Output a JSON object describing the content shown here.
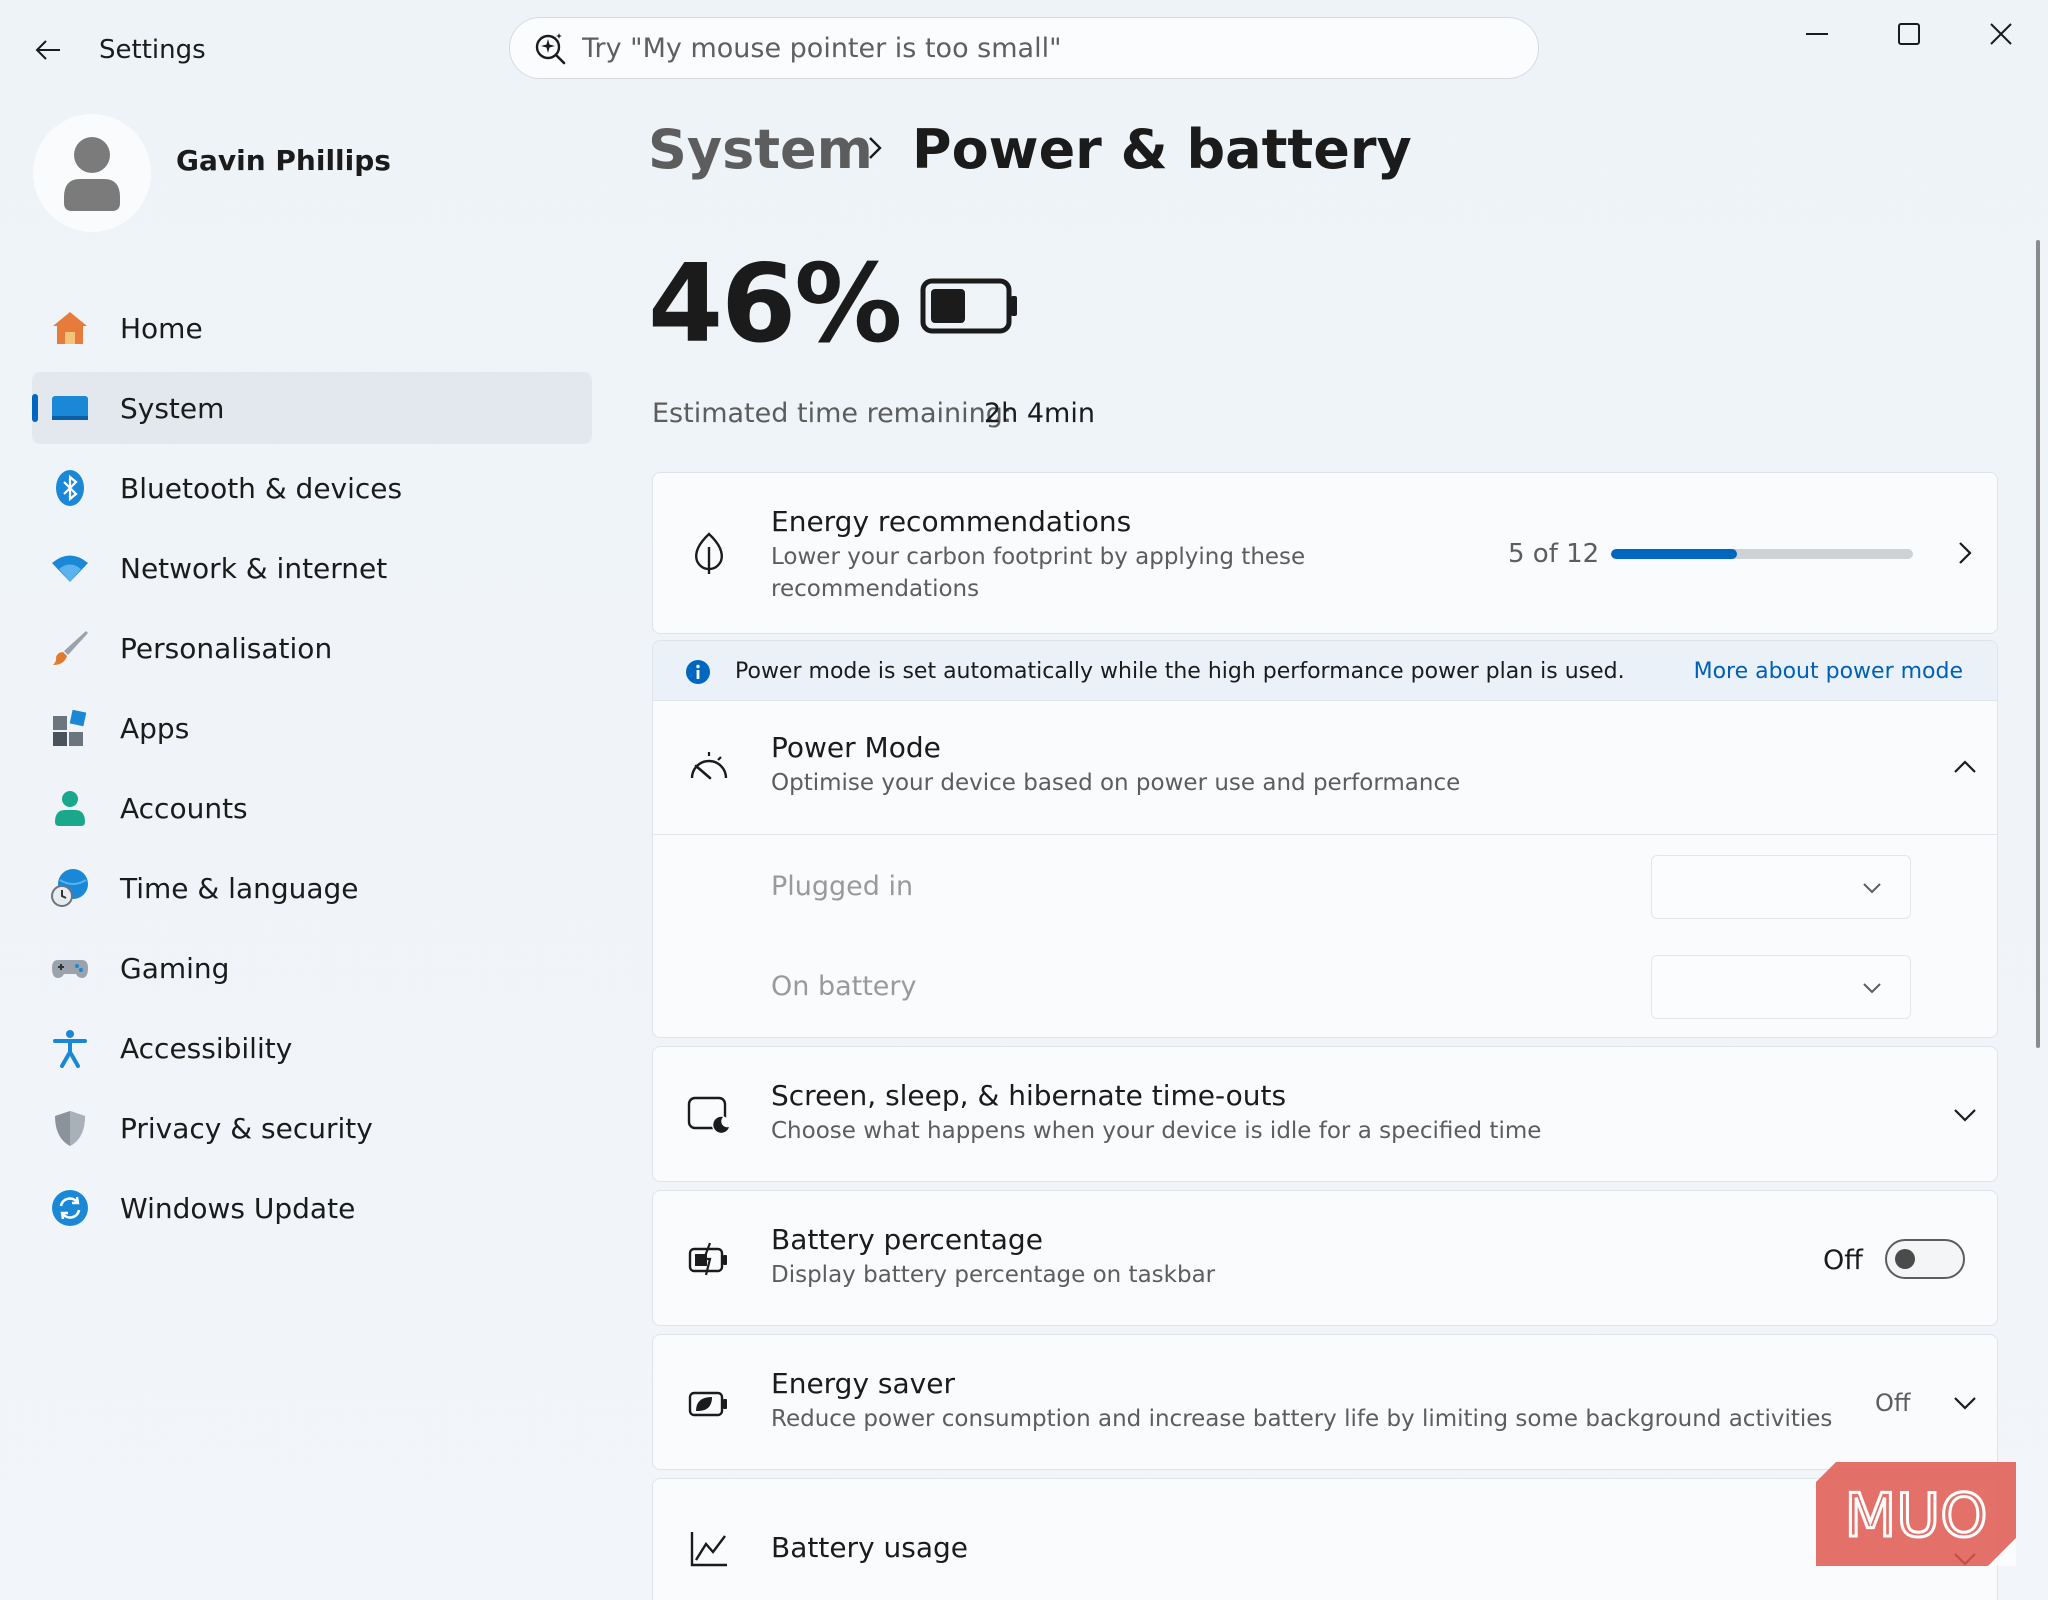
{
  "window": {
    "title": "Settings"
  },
  "search": {
    "placeholder": "Try \"My mouse pointer is too small\""
  },
  "profile": {
    "name": "Gavin Phillips"
  },
  "nav": {
    "items": [
      {
        "label": "Home",
        "icon": "home-icon"
      },
      {
        "label": "System",
        "icon": "system-icon",
        "active": true
      },
      {
        "label": "Bluetooth & devices",
        "icon": "bluetooth-icon"
      },
      {
        "label": "Network & internet",
        "icon": "wifi-icon"
      },
      {
        "label": "Personalisation",
        "icon": "paintbrush-icon"
      },
      {
        "label": "Apps",
        "icon": "apps-icon"
      },
      {
        "label": "Accounts",
        "icon": "accounts-icon"
      },
      {
        "label": "Time & language",
        "icon": "globe-clock-icon"
      },
      {
        "label": "Gaming",
        "icon": "gamepad-icon"
      },
      {
        "label": "Accessibility",
        "icon": "accessibility-icon"
      },
      {
        "label": "Privacy & security",
        "icon": "shield-icon"
      },
      {
        "label": "Windows Update",
        "icon": "update-icon"
      }
    ]
  },
  "header": {
    "breadcrumb_parent": "System",
    "title": "Power & battery"
  },
  "battery": {
    "percent_label": "46%",
    "level": 0.46,
    "estimate_label": "Estimated time remaining:",
    "estimate_value": "2h 4min"
  },
  "energy_recommendations": {
    "title": "Energy recommendations",
    "subtitle_line1": "Lower your carbon footprint by applying these",
    "subtitle_line2": "recommendations",
    "count_label": "5 of 12",
    "applied": 5,
    "total": 12
  },
  "info_bar": {
    "text": "Power mode is set automatically while the high performance power plan is used.",
    "link": "More about power mode"
  },
  "power_mode": {
    "title": "Power Mode",
    "subtitle": "Optimise your device based on power use and performance",
    "plugged_in_label": "Plugged in",
    "on_battery_label": "On battery"
  },
  "screen_sleep": {
    "title": "Screen, sleep, & hibernate time-outs",
    "subtitle": "Choose what happens when your device is idle for a specified time"
  },
  "battery_percentage": {
    "title": "Battery percentage",
    "subtitle": "Display battery percentage on taskbar",
    "state": "Off"
  },
  "energy_saver": {
    "title": "Energy saver",
    "subtitle": "Reduce power consumption and increase battery life by limiting some background activities",
    "state": "Off"
  },
  "battery_usage": {
    "title": "Battery usage"
  },
  "colors": {
    "accent": "#0067c0",
    "link": "#005fb8"
  },
  "watermark": {
    "text": "MUO"
  }
}
